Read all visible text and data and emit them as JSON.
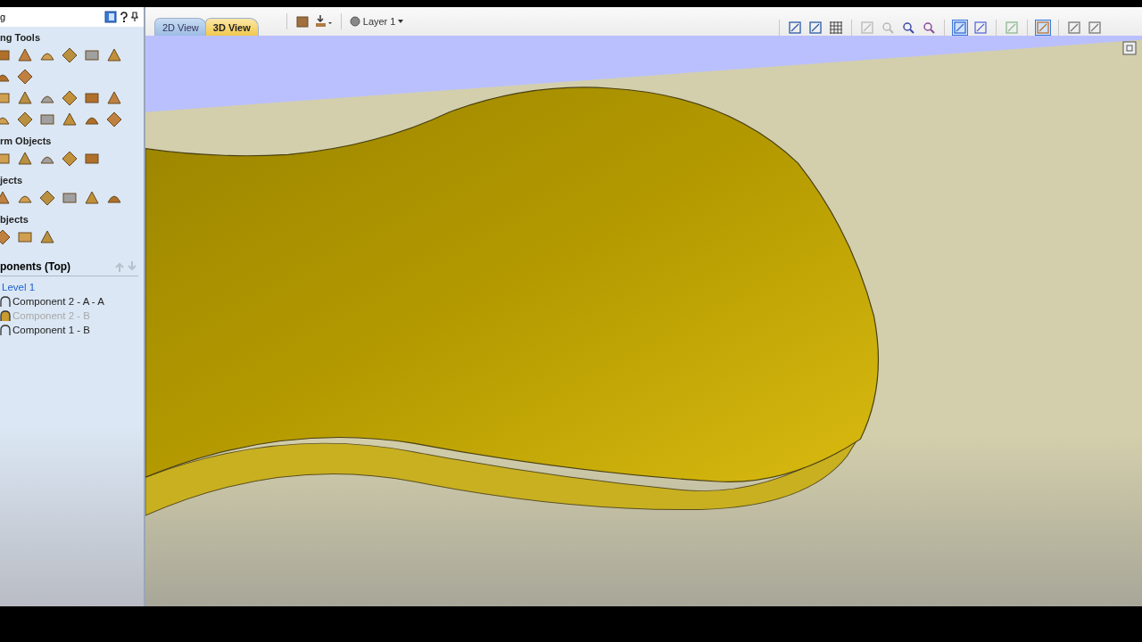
{
  "panel": {
    "title": "g",
    "sections": [
      {
        "title": "ng Tools"
      },
      {
        "title": "rm Objects"
      },
      {
        "title": "jects"
      },
      {
        "title": "bjects"
      }
    ],
    "components": {
      "title": "ponents (Top)",
      "tree": [
        {
          "label": "Level 1",
          "selected": true,
          "children": [
            {
              "label": "Component 2 - A - A",
              "selected": false,
              "visible": true
            },
            {
              "label": "Component 2 - B",
              "selected": false,
              "visible": false
            },
            {
              "label": "Component 1 - B",
              "selected": false,
              "visible": true
            }
          ]
        }
      ]
    }
  },
  "tabs": [
    {
      "label": "2D View",
      "selected": false
    },
    {
      "label": "3D View",
      "selected": true
    }
  ],
  "layer": {
    "label": "Layer 1"
  },
  "view_tools": [
    [
      {
        "on": false
      },
      {
        "on": false
      },
      {
        "on": false
      }
    ],
    [
      {
        "on": false
      },
      {
        "on": false
      },
      {
        "on": false
      },
      {
        "on": false
      }
    ],
    [
      {
        "on": true
      },
      {
        "on": false
      }
    ],
    [
      {
        "on": false
      }
    ],
    [
      {
        "on": true
      }
    ],
    [
      {
        "on": false
      },
      {
        "on": false
      }
    ]
  ]
}
